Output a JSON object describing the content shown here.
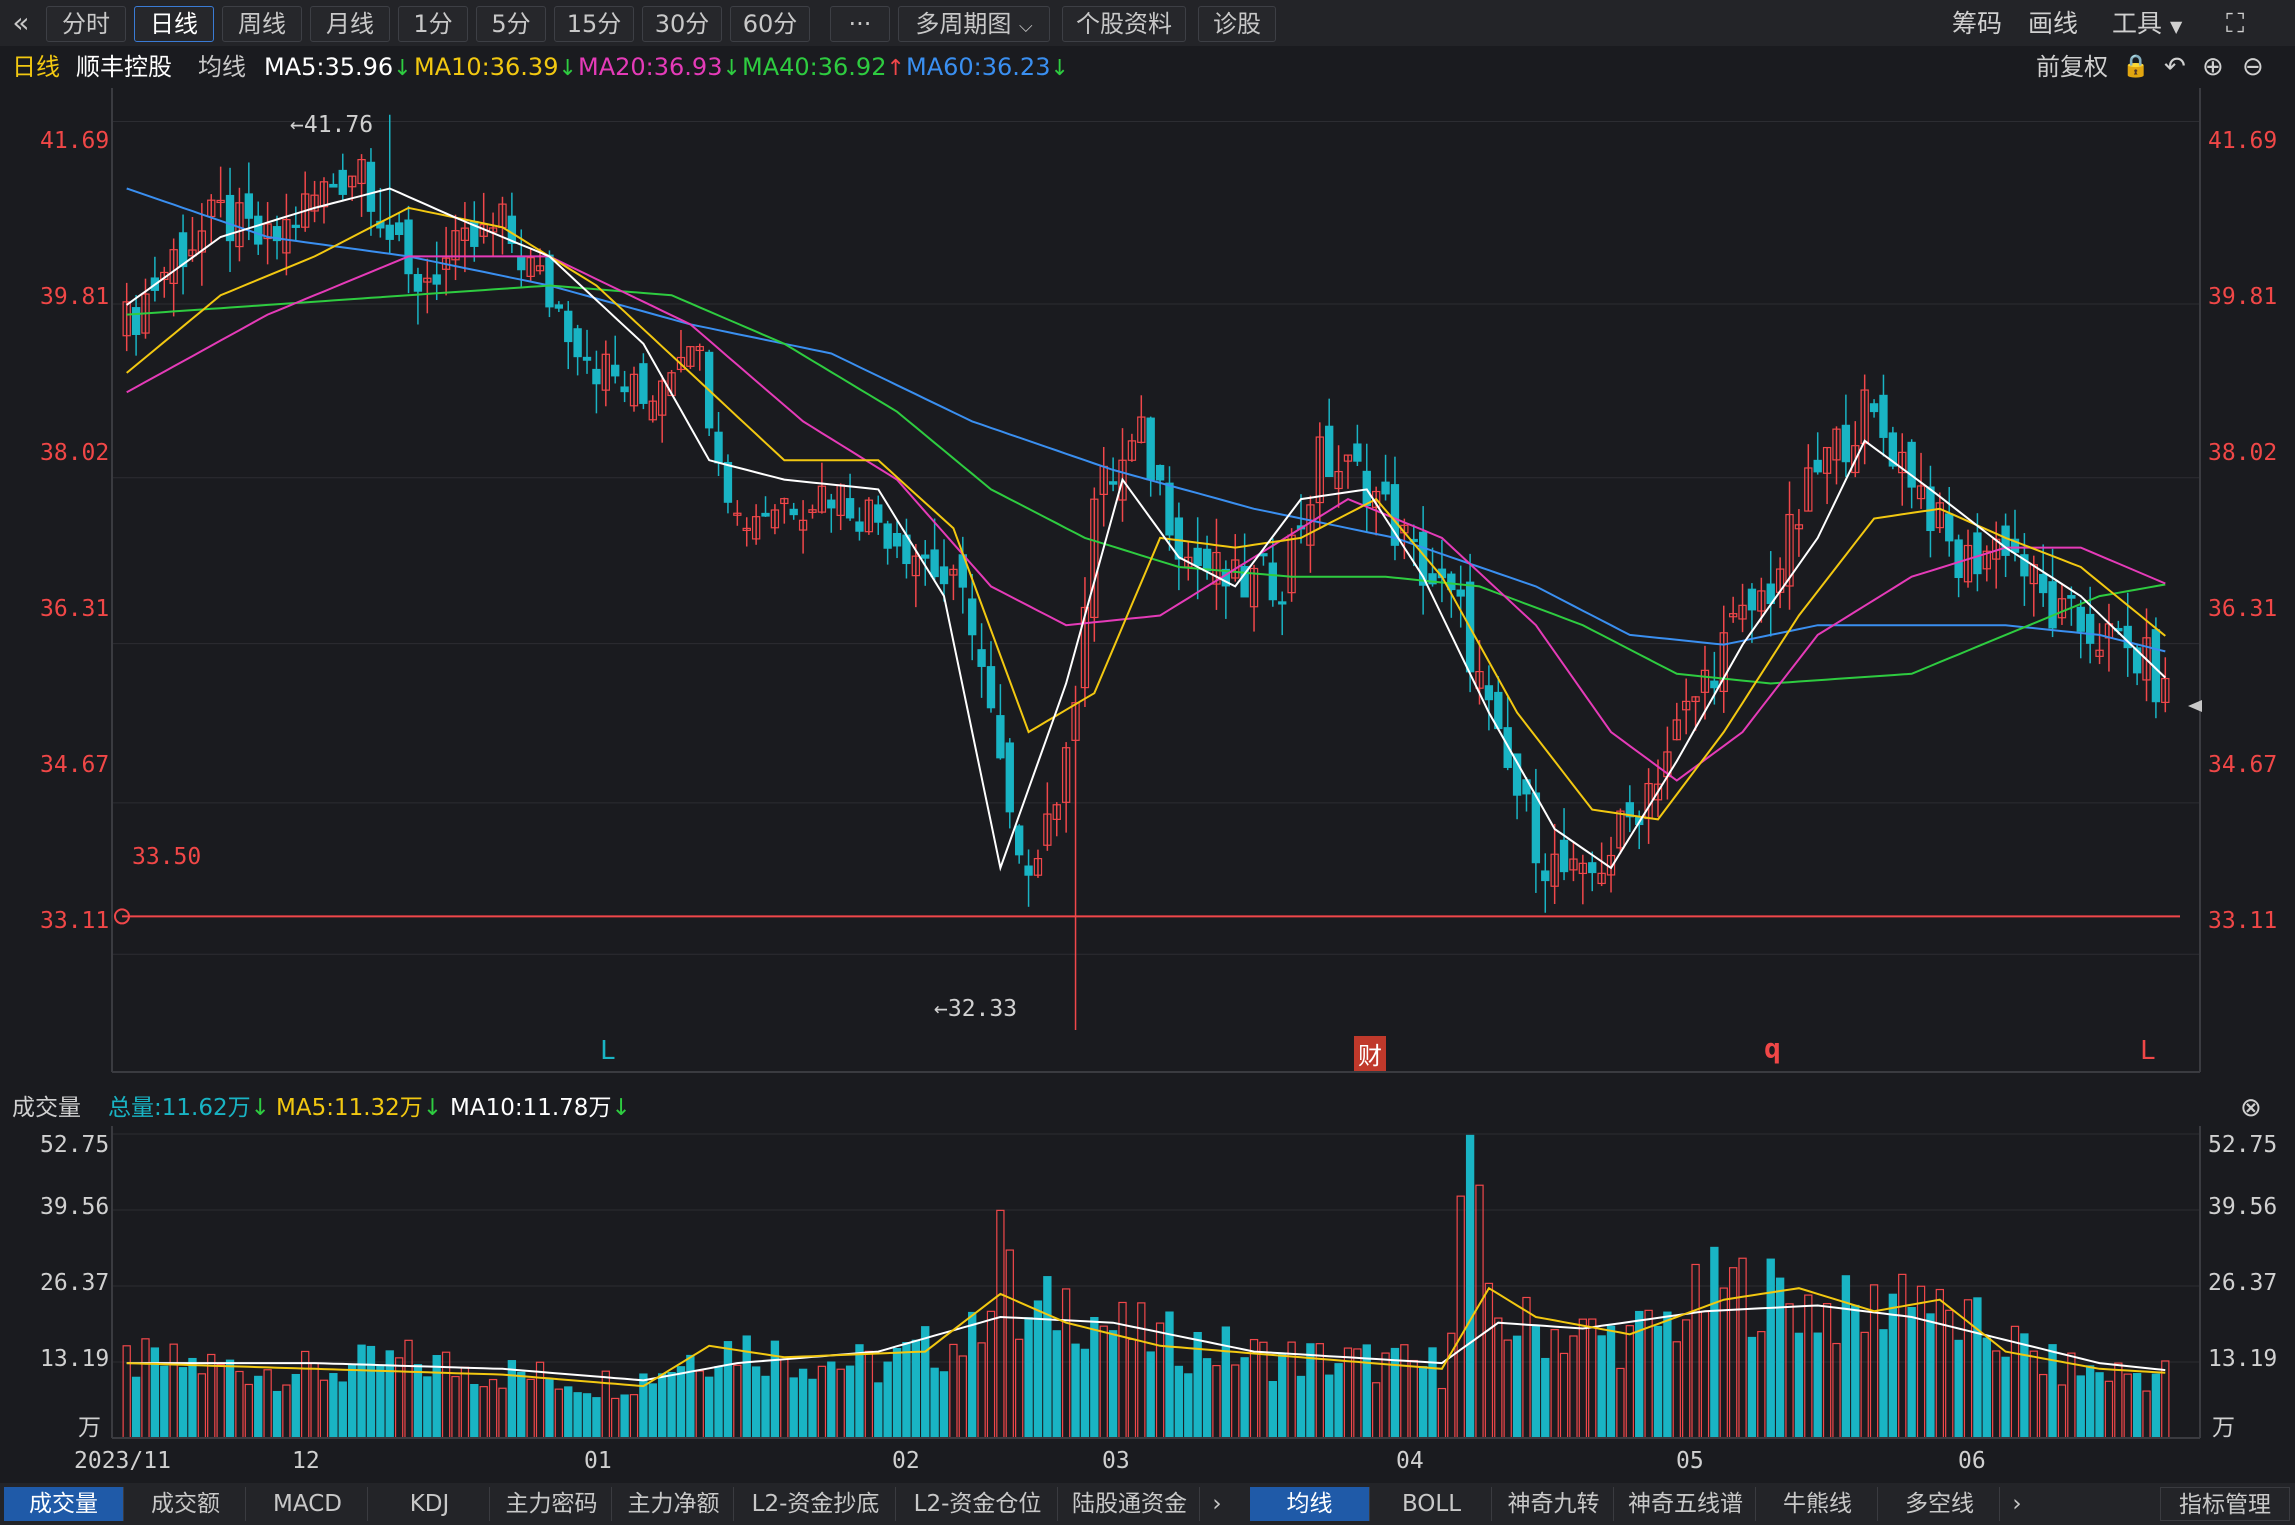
{
  "toolbar": {
    "collapse_icon": "double-chevron-left-icon",
    "periods": [
      "分时",
      "日线",
      "周线",
      "月线",
      "1分",
      "5分",
      "15分",
      "30分",
      "60分"
    ],
    "active_period": "日线",
    "more_label": "···",
    "multi_period": "多周期图",
    "stock_info": "个股资料",
    "diagnose": "诊股",
    "chips": "筹码",
    "draw": "画线",
    "tools": "工具",
    "fullscreen_icon": "fullscreen-icon"
  },
  "info": {
    "period": "日线",
    "stock_name": "顺丰控股",
    "ma_label": "均线",
    "ma5": "MA5:35.96",
    "ma10": "MA10:36.39",
    "ma20": "MA20:36.93",
    "ma40": "MA40:36.92",
    "ma60": "MA60:36.23",
    "adjust": "前复权",
    "arrow_down": "↓",
    "arrow_up": "↑"
  },
  "price_axis": {
    "ticks": [
      "41.69",
      "39.81",
      "38.02",
      "36.31",
      "34.67",
      "33.11"
    ],
    "high_marker": "←41.76",
    "low_marker": "←32.33",
    "support_label": "33.50",
    "event_markers": [
      "L",
      "财",
      "q",
      "L"
    ]
  },
  "volume": {
    "title": "成交量",
    "total": "总量:11.62万",
    "ma5": "MA5:11.32万",
    "ma10": "MA10:11.78万",
    "ticks": [
      "52.75",
      "39.56",
      "26.37",
      "13.19",
      "万"
    ],
    "close_icon": "close-circle-icon"
  },
  "date_axis": [
    "2023/11",
    "12",
    "01",
    "02",
    "03",
    "04",
    "05",
    "06"
  ],
  "bottom_tabs_left": [
    "成交量",
    "成交额",
    "MACD",
    "KDJ",
    "主力密码",
    "主力净额",
    "L2-资金抄底",
    "L2-资金仓位",
    "陆股通资金"
  ],
  "bottom_tabs_right": [
    "均线",
    "BOLL",
    "神奇九转",
    "神奇五线谱",
    "牛熊线",
    "多空线"
  ],
  "indicator_manage": "指标管理",
  "colors": {
    "up": "#f0474a",
    "down": "#19b4c4",
    "ma5": "#ffffff",
    "ma10": "#f2c811",
    "ma20": "#e53bb8",
    "ma40": "#2ecc40",
    "ma60": "#3a8ff0",
    "axis_label": "#f04747"
  },
  "chart_data": {
    "type": "candlestick",
    "ylim": [
      32.0,
      42.2
    ],
    "support_line": 33.5,
    "high": 41.76,
    "low": 32.33,
    "close_points": [
      [
        0,
        39.6
      ],
      [
        5,
        40.3
      ],
      [
        10,
        40.7
      ],
      [
        15,
        40.4
      ],
      [
        20,
        40.9
      ],
      [
        25,
        41.3
      ],
      [
        30,
        40.0
      ],
      [
        35,
        40.3
      ],
      [
        40,
        40.6
      ],
      [
        45,
        39.9
      ],
      [
        50,
        39.2
      ],
      [
        55,
        38.8
      ],
      [
        60,
        39.6
      ],
      [
        65,
        37.6
      ],
      [
        70,
        37.8
      ],
      [
        75,
        37.9
      ],
      [
        80,
        37.6
      ],
      [
        85,
        37.2
      ],
      [
        90,
        36.6
      ],
      [
        95,
        33.9
      ],
      [
        100,
        35.0
      ],
      [
        103,
        37.8
      ],
      [
        108,
        38.4
      ],
      [
        113,
        37.2
      ],
      [
        118,
        36.9
      ],
      [
        123,
        37.0
      ],
      [
        127,
        38.2
      ],
      [
        132,
        38.0
      ],
      [
        137,
        37.2
      ],
      [
        142,
        36.6
      ],
      [
        146,
        35.2
      ],
      [
        151,
        34.1
      ],
      [
        155,
        33.8
      ],
      [
        160,
        34.5
      ],
      [
        165,
        35.4
      ],
      [
        170,
        36.3
      ],
      [
        175,
        36.9
      ],
      [
        180,
        38.1
      ],
      [
        185,
        38.7
      ],
      [
        190,
        38.1
      ],
      [
        195,
        37.1
      ],
      [
        200,
        37.4
      ],
      [
        205,
        36.6
      ],
      [
        210,
        36.4
      ],
      [
        215,
        36.1
      ],
      [
        217,
        35.75
      ]
    ],
    "ma5": [
      [
        0,
        39.8
      ],
      [
        10,
        40.5
      ],
      [
        20,
        40.8
      ],
      [
        28,
        41.0
      ],
      [
        35,
        40.7
      ],
      [
        45,
        40.3
      ],
      [
        55,
        39.4
      ],
      [
        62,
        38.2
      ],
      [
        70,
        38.0
      ],
      [
        80,
        37.9
      ],
      [
        87,
        36.8
      ],
      [
        93,
        34.0
      ],
      [
        100,
        35.9
      ],
      [
        106,
        38.0
      ],
      [
        112,
        37.2
      ],
      [
        118,
        36.9
      ],
      [
        125,
        37.8
      ],
      [
        132,
        37.9
      ],
      [
        138,
        37.0
      ],
      [
        145,
        35.6
      ],
      [
        152,
        34.4
      ],
      [
        158,
        34.0
      ],
      [
        165,
        35.1
      ],
      [
        172,
        36.3
      ],
      [
        180,
        37.4
      ],
      [
        185,
        38.4
      ],
      [
        192,
        37.9
      ],
      [
        200,
        37.3
      ],
      [
        208,
        36.8
      ],
      [
        217,
        35.96
      ]
    ],
    "ma10": [
      [
        0,
        39.1
      ],
      [
        10,
        39.9
      ],
      [
        20,
        40.3
      ],
      [
        30,
        40.8
      ],
      [
        40,
        40.6
      ],
      [
        50,
        40.0
      ],
      [
        60,
        39.1
      ],
      [
        70,
        38.2
      ],
      [
        80,
        38.2
      ],
      [
        88,
        37.5
      ],
      [
        96,
        35.4
      ],
      [
        103,
        35.8
      ],
      [
        110,
        37.4
      ],
      [
        118,
        37.3
      ],
      [
        125,
        37.4
      ],
      [
        133,
        37.8
      ],
      [
        140,
        37.0
      ],
      [
        148,
        35.6
      ],
      [
        156,
        34.6
      ],
      [
        163,
        34.5
      ],
      [
        170,
        35.4
      ],
      [
        178,
        36.6
      ],
      [
        186,
        37.6
      ],
      [
        193,
        37.7
      ],
      [
        200,
        37.4
      ],
      [
        208,
        37.1
      ],
      [
        217,
        36.39
      ]
    ],
    "ma20": [
      [
        0,
        38.9
      ],
      [
        15,
        39.7
      ],
      [
        30,
        40.3
      ],
      [
        45,
        40.3
      ],
      [
        60,
        39.6
      ],
      [
        72,
        38.6
      ],
      [
        82,
        38.0
      ],
      [
        92,
        36.9
      ],
      [
        100,
        36.5
      ],
      [
        110,
        36.6
      ],
      [
        120,
        37.2
      ],
      [
        130,
        37.8
      ],
      [
        140,
        37.4
      ],
      [
        150,
        36.5
      ],
      [
        158,
        35.4
      ],
      [
        165,
        34.9
      ],
      [
        172,
        35.4
      ],
      [
        180,
        36.4
      ],
      [
        190,
        37.0
      ],
      [
        200,
        37.3
      ],
      [
        208,
        37.3
      ],
      [
        217,
        36.93
      ]
    ],
    "ma40": [
      [
        0,
        39.7
      ],
      [
        15,
        39.8
      ],
      [
        30,
        39.9
      ],
      [
        45,
        40.0
      ],
      [
        58,
        39.9
      ],
      [
        70,
        39.4
      ],
      [
        82,
        38.7
      ],
      [
        92,
        37.9
      ],
      [
        102,
        37.4
      ],
      [
        112,
        37.1
      ],
      [
        124,
        37.0
      ],
      [
        134,
        37.0
      ],
      [
        144,
        36.9
      ],
      [
        155,
        36.5
      ],
      [
        165,
        36.0
      ],
      [
        175,
        35.9
      ],
      [
        190,
        36.0
      ],
      [
        200,
        36.4
      ],
      [
        210,
        36.8
      ],
      [
        217,
        36.92
      ]
    ],
    "ma60": [
      [
        0,
        41.0
      ],
      [
        15,
        40.5
      ],
      [
        30,
        40.3
      ],
      [
        45,
        40.0
      ],
      [
        60,
        39.6
      ],
      [
        75,
        39.3
      ],
      [
        90,
        38.6
      ],
      [
        105,
        38.1
      ],
      [
        120,
        37.7
      ],
      [
        135,
        37.4
      ],
      [
        150,
        36.9
      ],
      [
        160,
        36.4
      ],
      [
        170,
        36.3
      ],
      [
        180,
        36.5
      ],
      [
        190,
        36.5
      ],
      [
        200,
        36.5
      ],
      [
        210,
        36.4
      ],
      [
        217,
        36.23
      ]
    ],
    "volume_ylim": [
      0,
      52.75
    ],
    "volume_series": [
      [
        0,
        14
      ],
      [
        10,
        13
      ],
      [
        20,
        12
      ],
      [
        30,
        14
      ],
      [
        40,
        12
      ],
      [
        50,
        10
      ],
      [
        55,
        11
      ],
      [
        60,
        15
      ],
      [
        65,
        17
      ],
      [
        70,
        15
      ],
      [
        80,
        13
      ],
      [
        85,
        16
      ],
      [
        90,
        18
      ],
      [
        93,
        35
      ],
      [
        95,
        20
      ],
      [
        100,
        25
      ],
      [
        105,
        20
      ],
      [
        110,
        18
      ],
      [
        120,
        15
      ],
      [
        130,
        14
      ],
      [
        140,
        13
      ],
      [
        143,
        52
      ],
      [
        145,
        22
      ],
      [
        150,
        20
      ],
      [
        160,
        18
      ],
      [
        165,
        22
      ],
      [
        170,
        28
      ],
      [
        175,
        26
      ],
      [
        180,
        24
      ],
      [
        185,
        22
      ],
      [
        190,
        30
      ],
      [
        193,
        22
      ],
      [
        200,
        18
      ],
      [
        205,
        13
      ],
      [
        210,
        12
      ],
      [
        217,
        11.62
      ]
    ],
    "vol_ma5": [
      [
        0,
        13
      ],
      [
        20,
        12
      ],
      [
        40,
        11
      ],
      [
        55,
        9
      ],
      [
        62,
        16
      ],
      [
        70,
        14
      ],
      [
        85,
        15
      ],
      [
        93,
        25
      ],
      [
        100,
        20
      ],
      [
        110,
        16
      ],
      [
        125,
        14
      ],
      [
        140,
        12
      ],
      [
        145,
        26
      ],
      [
        150,
        21
      ],
      [
        160,
        18
      ],
      [
        170,
        24
      ],
      [
        178,
        26
      ],
      [
        186,
        22
      ],
      [
        193,
        24
      ],
      [
        200,
        15
      ],
      [
        210,
        12
      ],
      [
        217,
        11.32
      ]
    ],
    "vol_ma10": [
      [
        0,
        13
      ],
      [
        20,
        13
      ],
      [
        40,
        12
      ],
      [
        55,
        10
      ],
      [
        65,
        13
      ],
      [
        80,
        15
      ],
      [
        93,
        21
      ],
      [
        105,
        20
      ],
      [
        120,
        15
      ],
      [
        140,
        13
      ],
      [
        146,
        20
      ],
      [
        155,
        19
      ],
      [
        168,
        22
      ],
      [
        180,
        23
      ],
      [
        190,
        21
      ],
      [
        200,
        17
      ],
      [
        210,
        13
      ],
      [
        217,
        11.78
      ]
    ]
  }
}
